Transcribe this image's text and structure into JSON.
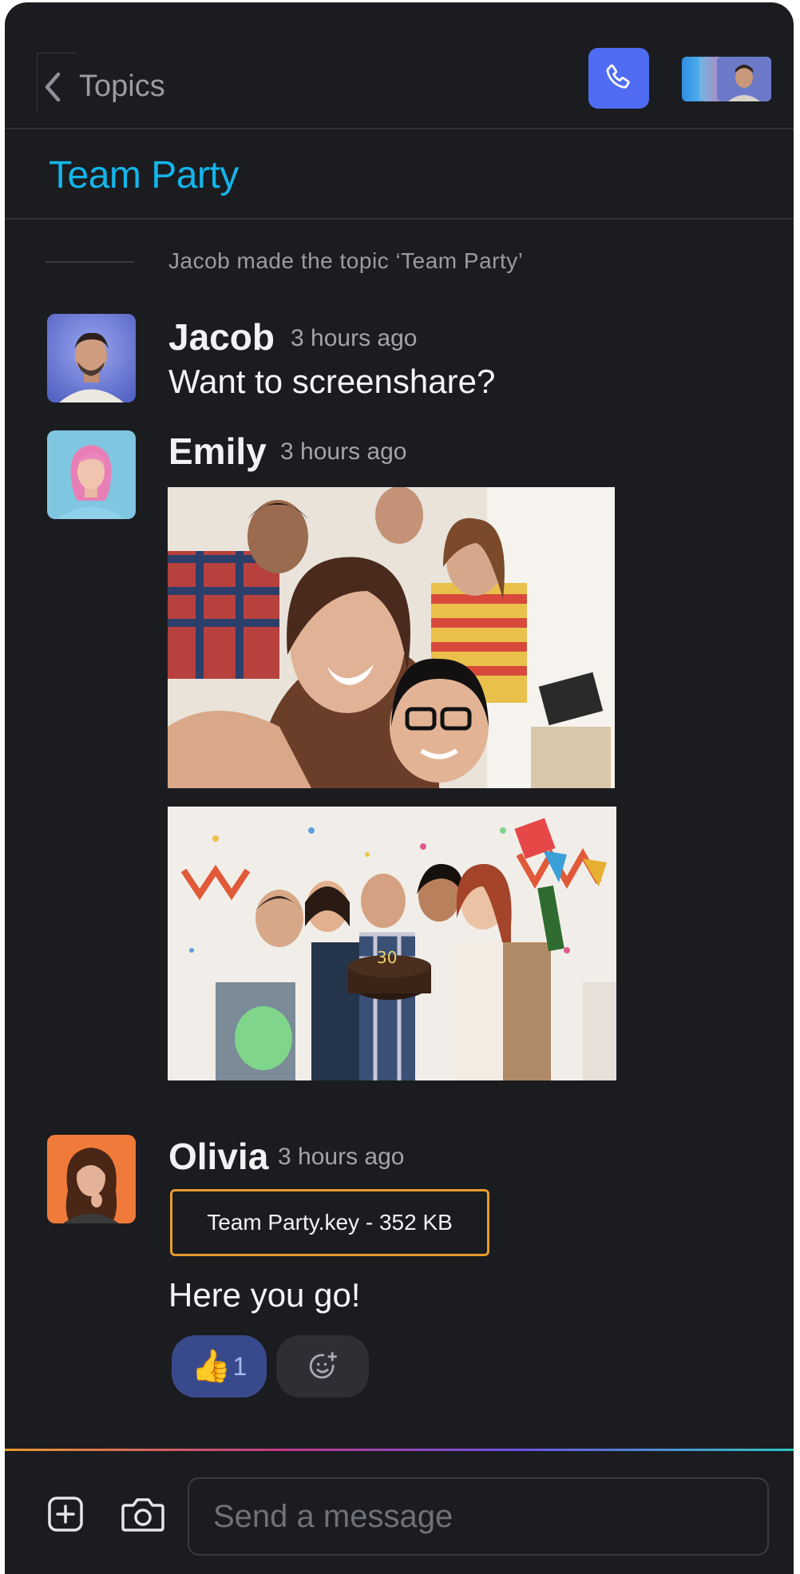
{
  "header": {
    "back_label": "Topics"
  },
  "topic": {
    "title": "Team Party",
    "system_message": "Jacob made the topic ‘Team Party’"
  },
  "messages": [
    {
      "author": "Jacob",
      "time": "3 hours ago",
      "text": "Want to screenshare?"
    },
    {
      "author": "Emily",
      "time": "3 hours ago"
    },
    {
      "author": "Olivia",
      "time": "3 hours ago",
      "attachment": "Team Party.key - 352 KB",
      "text": "Here you go!"
    }
  ],
  "reactions": [
    {
      "emoji": "👍",
      "count": "1"
    }
  ],
  "composer": {
    "placeholder": "Send a message"
  },
  "colors": {
    "background": "#1b1c20",
    "accent_topic": "#13b5ea",
    "call_button": "#4f6cf3",
    "file_border": "#e69c2c",
    "reaction_bg": "#394a8c"
  }
}
